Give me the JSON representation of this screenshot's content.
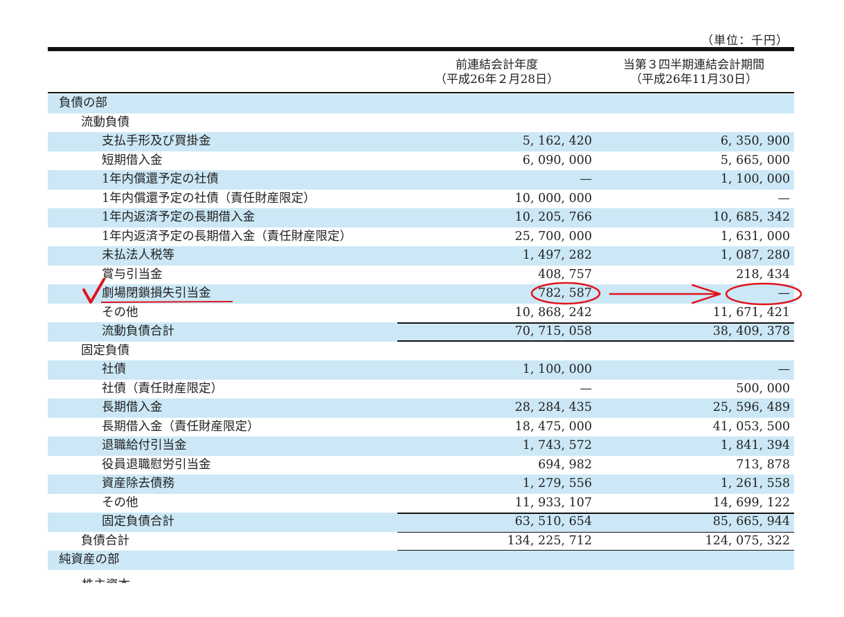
{
  "unit_label": "（単位：千円）",
  "header": {
    "prev_period": "前連結会計年度",
    "prev_date": "（平成26年２月28日）",
    "curr_period": "当第３四半期連結会計期間",
    "curr_date": "（平成26年11月30日）"
  },
  "rows": [
    {
      "label": "負債の部",
      "prev": "",
      "curr": ""
    },
    {
      "label": "流動負債",
      "prev": "",
      "curr": ""
    },
    {
      "label": "支払手形及び買掛金",
      "prev": "5, 162, 420",
      "curr": "6, 350, 900"
    },
    {
      "label": "短期借入金",
      "prev": "6, 090, 000",
      "curr": "5, 665, 000"
    },
    {
      "label": "1年内償還予定の社債",
      "prev": "—",
      "curr": "1, 100, 000"
    },
    {
      "label": "1年内償還予定の社債（責任財産限定）",
      "prev": "10, 000, 000",
      "curr": "—"
    },
    {
      "label": "1年内返済予定の長期借入金",
      "prev": "10, 205, 766",
      "curr": "10, 685, 342"
    },
    {
      "label": "1年内返済予定の長期借入金（責任財産限定）",
      "prev": "25, 700, 000",
      "curr": "1, 631, 000"
    },
    {
      "label": "未払法人税等",
      "prev": "1, 497, 282",
      "curr": "1, 087, 280"
    },
    {
      "label": "賞与引当金",
      "prev": "408, 757",
      "curr": "218, 434"
    },
    {
      "label": "劇場閉鎖損失引当金",
      "prev": "782, 587",
      "curr": "—"
    },
    {
      "label": "その他",
      "prev": "10, 868, 242",
      "curr": "11, 671, 421"
    },
    {
      "label": "流動負債合計",
      "prev": "70, 715, 058",
      "curr": "38, 409, 378"
    },
    {
      "label": "固定負債",
      "prev": "",
      "curr": ""
    },
    {
      "label": "社債",
      "prev": "1, 100, 000",
      "curr": "—"
    },
    {
      "label": "社債（責任財産限定）",
      "prev": "—",
      "curr": "500, 000"
    },
    {
      "label": "長期借入金",
      "prev": "28, 284, 435",
      "curr": "25, 596, 489"
    },
    {
      "label": "長期借入金（責任財産限定）",
      "prev": "18, 475, 000",
      "curr": "41, 053, 500"
    },
    {
      "label": "退職給付引当金",
      "prev": "1, 743, 572",
      "curr": "1, 841, 394"
    },
    {
      "label": "役員退職慰労引当金",
      "prev": "694, 982",
      "curr": "713, 878"
    },
    {
      "label": "資産除去債務",
      "prev": "1, 279, 556",
      "curr": "1, 261, 558"
    },
    {
      "label": "その他",
      "prev": "11, 933, 107",
      "curr": "14, 699, 122"
    },
    {
      "label": "固定負債合計",
      "prev": "63, 510, 654",
      "curr": "85, 665, 944"
    },
    {
      "label": "負債合計",
      "prev": "134, 225, 712",
      "curr": "124, 075, 322"
    },
    {
      "label": "純資産の部",
      "prev": "",
      "curr": ""
    }
  ],
  "cut_off_label": "株主資本",
  "annotation": {
    "ink_color": "#e0141c",
    "marks": [
      "check-mark-icon",
      "underline",
      "circle-prev-value",
      "arrow",
      "circle-curr-value"
    ]
  }
}
